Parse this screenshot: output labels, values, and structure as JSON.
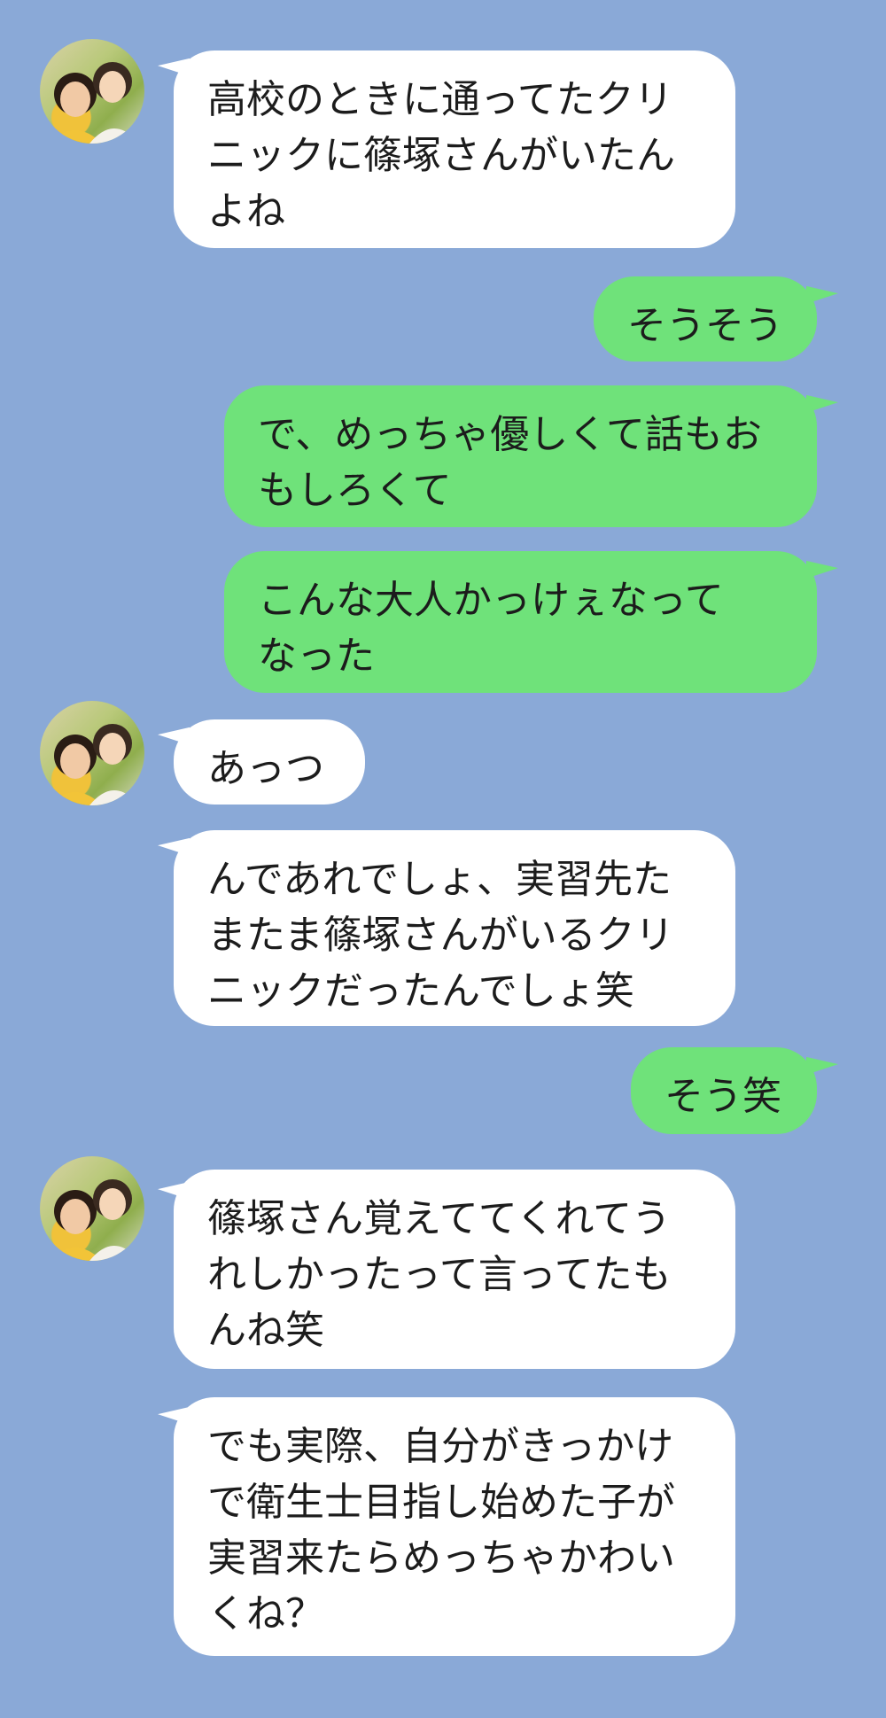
{
  "contact": {
    "avatar_icon": "two-women-photo-avatar"
  },
  "colors": {
    "background": "#8aa9d7",
    "incoming_bubble": "#ffffff",
    "outgoing_bubble": "#6fe27a",
    "text": "#1c1c1c"
  },
  "messages": [
    {
      "sender": "them",
      "text": "高校のときに通ってたクリ\nニックに篠塚さんがいたん\nよね"
    },
    {
      "sender": "me",
      "text": "そうそう"
    },
    {
      "sender": "me",
      "text": "で、めっちゃ優しくて話もお\nもしろくて"
    },
    {
      "sender": "me",
      "text": "こんな大人かっけぇなって\nなった"
    },
    {
      "sender": "them",
      "text": "あっつ"
    },
    {
      "sender": "them",
      "text": "んであれでしょ、実習先た\nまたま篠塚さんがいるクリ\nニックだったんでしょ笑"
    },
    {
      "sender": "me",
      "text": "そう笑"
    },
    {
      "sender": "them",
      "text": "篠塚さん覚えててくれてう\nれしかったって言ってたも\nんね笑"
    },
    {
      "sender": "them",
      "text": "でも実際、自分がきっかけ\nで衛生士目指し始めた子が\n実習来たらめっちゃかわい\nくね？"
    }
  ]
}
